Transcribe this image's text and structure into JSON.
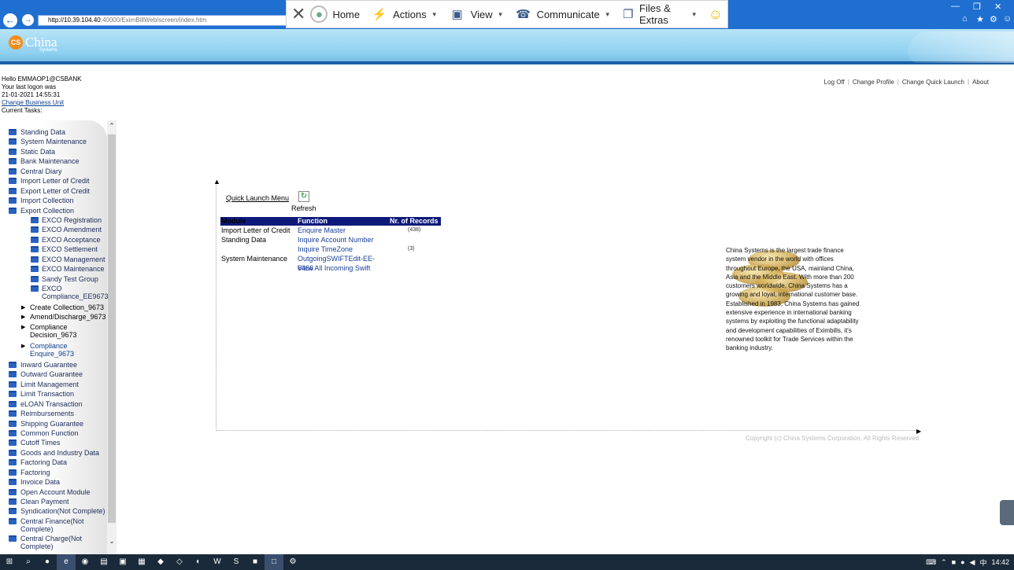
{
  "browser": {
    "url_host": "http://10.39.104.40",
    "url_rest": ":40000/EximBillWeb/screen/index.htm",
    "back_icon": "back-arrow-icon",
    "forward_icon": "forward-arrow-icon",
    "window_controls": [
      "—",
      "❐",
      "✕"
    ],
    "bar_color": "#1e6fd0"
  },
  "remote_toolbar": {
    "items": [
      {
        "label": "Home",
        "icon": "home-icon"
      },
      {
        "label": "Actions",
        "icon": "lightning-icon"
      },
      {
        "label": "View",
        "icon": "monitor-icon"
      },
      {
        "label": "Communicate",
        "icon": "chat-icon"
      },
      {
        "label": "Files & Extras",
        "icon": "file-icon"
      }
    ]
  },
  "app": {
    "logo_badge": "CS",
    "logo_name": "China",
    "logo_sub": "Systems"
  },
  "user": {
    "greeting": "Hello EMMAOP1@CSBANK",
    "last_logon_label": "Your last logon was",
    "last_logon_time": "21-01-2021 14:55:31",
    "change_unit": "Change Business Unit",
    "current_tasks": "Current Tasks:"
  },
  "top_links": [
    "Log Off",
    "Change Profile",
    "Change Quick Launch",
    "About"
  ],
  "sidebar": {
    "items_top": [
      "Standing Data",
      "System Maintenance",
      "Static Data",
      "Bank Maintenance",
      "Central Diary",
      "Import Letter of Credit",
      "Export Letter of Credit",
      "Import Collection",
      "Export Collection"
    ],
    "export_collection_children": [
      "EXCO Registration",
      "EXCO Amendment",
      "EXCO Acceptance",
      "EXCO Settlement",
      "EXCO Management",
      "EXCO Maintenance",
      "Sandy Test Group",
      "EXCO Compliance_EE9673"
    ],
    "compliance_children": [
      "Create Collection_9673",
      "Amend/Discharge_9673",
      "Compliance Decision_9673",
      "Compliance Enquire_9673"
    ],
    "items_bottom": [
      "Inward Guarantee",
      "Outward Guarantee",
      "Limit Management",
      "Limit Transaction",
      "eLOAN Transaction",
      "Reimbursements",
      "Shipping Guarantee",
      "Common Function",
      "Cutoff Times",
      "Goods and Industry Data",
      "Factoring Data",
      "Factoring",
      "Invoice Data",
      "Open Account Module",
      "Clean Payment",
      "Syndication(Not Complete)",
      "Central Finance(Not Complete)",
      "Central Charge(Not Complete)"
    ]
  },
  "quick_launch": {
    "title": "Quick Launch Menu",
    "refresh_label": "Refresh",
    "headers": [
      "Module",
      "Function",
      "Nr. of Records"
    ],
    "rows": [
      {
        "module": "Import Letter of Credit",
        "function": "Enquire Master",
        "records": "(438)"
      },
      {
        "module": "Standing Data",
        "function": "Inquire Account Number",
        "records": ""
      },
      {
        "module": "",
        "function": "Inquire TimeZone",
        "records": "(3)"
      },
      {
        "module": "System Maintenance",
        "function": "OutgoingSWIFTEdit-EE-6466",
        "records": ""
      },
      {
        "module": "",
        "function": "View All Incoming Swift",
        "records": ""
      }
    ]
  },
  "about_text": {
    "p1": "China Systems is the largest trade finance system vendor in the world with offices throughout Europe, the USA, mainland China, Asia and the Middle East. With more than 200 customers worldwide, China Systems has a growing and loyal, international customer base.",
    "p2": "Established in 1983, China Systems has gained extensive experience in international banking systems by exploiting the functional adaptability and development capabilities of Eximbills, it's renowned toolkit for Trade Services within the banking industry."
  },
  "copyright": "Copyright (c) China Systems Corporation, All Rights Reserved",
  "taskbar": {
    "time": "14:42"
  }
}
